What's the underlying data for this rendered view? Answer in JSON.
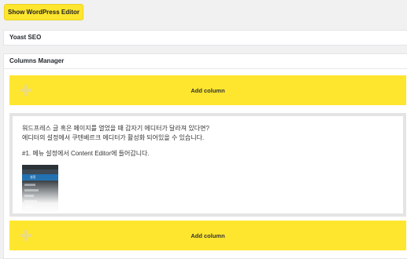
{
  "toolbar": {
    "show_editor_label": "Show WordPress Editor"
  },
  "yoast": {
    "title": "Yoast SEO"
  },
  "columns_manager": {
    "title": "Columns Manager",
    "add_column_label": "Add column",
    "content": {
      "line1": "워드프레스 글 혹은 페이지를 열었을 때 갑자기 에디터가 달라져 있다면?",
      "line2": "에디터의 설정에서 쿠텐베르크 에디터가 활성화 되어있을 수 있습니다.",
      "line3": "#1. 메뉴 설정에서 Content Editor에 들어갑니다.",
      "thumb_menu_label": "설정"
    }
  },
  "colors": {
    "accent": "#ffe62e"
  }
}
